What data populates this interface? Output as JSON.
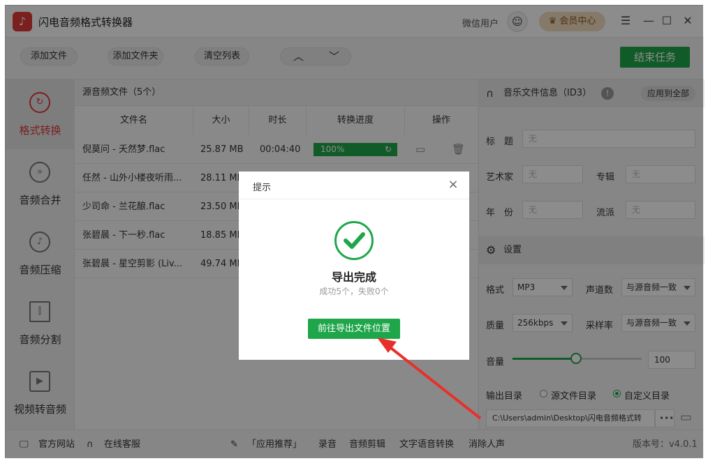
{
  "app": {
    "title": "闪电音频格式转换器",
    "logo_icon": "music-note-icon"
  },
  "titlebar": {
    "user": "微信用户",
    "vip": "会员中心",
    "min": "☰",
    "minimize": "—",
    "maximize": "☐",
    "close": "✕"
  },
  "toolbar": {
    "add_file": "添加文件",
    "add_folder": "添加文件夹",
    "clear_list": "清空列表",
    "end_task": "结束任务"
  },
  "sidebar": {
    "items": [
      {
        "label": "格式转换",
        "icon": "refresh-icon",
        "active": true
      },
      {
        "label": "音频合并",
        "icon": "merge-icon"
      },
      {
        "label": "音频压缩",
        "icon": "compress-icon"
      },
      {
        "label": "音频分割",
        "icon": "split-icon"
      },
      {
        "label": "视频转音频",
        "icon": "video-icon"
      }
    ]
  },
  "filelist": {
    "header": "源音频文件（5个）",
    "columns": [
      "文件名",
      "大小",
      "时长",
      "转换进度",
      "操作"
    ],
    "rows": [
      {
        "name": "倪莫问 - 夭然梦.flac",
        "size": "25.87 MB",
        "duration": "00:04:40",
        "progress": "100%"
      },
      {
        "name": "任然 - 山外小楼夜听雨...",
        "size": "28.11 MB",
        "duration": "",
        "progress": ""
      },
      {
        "name": "少司命 - 兰花酿.flac",
        "size": "23.50 MB",
        "duration": "",
        "progress": ""
      },
      {
        "name": "张碧晨 - 下一秒.flac",
        "size": "18.85 MB",
        "duration": "",
        "progress": ""
      },
      {
        "name": "张碧晨 - 星空剪影 (Liv...",
        "size": "49.74 MB",
        "duration": "",
        "progress": ""
      }
    ]
  },
  "id3": {
    "section": "音乐文件信息（ID3）",
    "apply_all": "应用到全部",
    "title_label": "标　题",
    "artist_label": "艺术家",
    "album_label": "专辑",
    "year_label": "年　份",
    "genre_label": "流派",
    "empty": "无"
  },
  "settings": {
    "section": "设置",
    "format_label": "格式",
    "format_value": "MP3",
    "channels_label": "声道数",
    "channels_value": "与源音频一致",
    "quality_label": "质量",
    "quality_value": "256kbps",
    "samplerate_label": "采样率",
    "samplerate_value": "与源音频一致",
    "volume_label": "音量",
    "volume_value": "100",
    "volume_fraction": 0.49,
    "output_label": "输出目录",
    "output_source": "源文件目录",
    "output_custom": "自定义目录",
    "output_path": "C:\\Users\\admin\\Desktop\\闪电音频格式转",
    "more": "•••"
  },
  "footer": {
    "website": "官方网站",
    "service": "在线客服",
    "recommend": "「应用推荐」",
    "record": "录音",
    "cut": "音频剪辑",
    "tts": "文字语音转换",
    "vocal": "消除人声",
    "version": "版本号：v4.0.1"
  },
  "dialog": {
    "title": "提示",
    "close": "×",
    "main": "导出完成",
    "sub": "成功5个，失败0个",
    "button": "前往导出文件位置"
  },
  "colors": {
    "accent": "#1fa64a",
    "brand": "#e03a3a"
  }
}
